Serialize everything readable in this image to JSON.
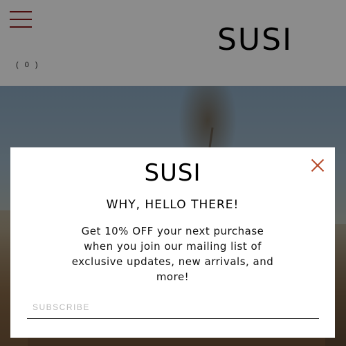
{
  "header": {
    "logo": "SUSI",
    "cart_count": "( 0 )"
  },
  "modal": {
    "logo": "SUSI",
    "heading": "WHY, HELLO THERE!",
    "body": "Get 10% OFF your next purchase when you join our mailing list of exclusive updates, new arrivals, and more!",
    "subscribe_placeholder": "SUBSCRIBE",
    "subscribe_value": ""
  },
  "colors": {
    "menu_icon": "#8b1a1a",
    "close_icon": "#b64a2a",
    "overlay": "rgba(0,0,0,0.45)"
  },
  "icons": {
    "menu": "hamburger-menu-icon",
    "close": "close-icon"
  }
}
